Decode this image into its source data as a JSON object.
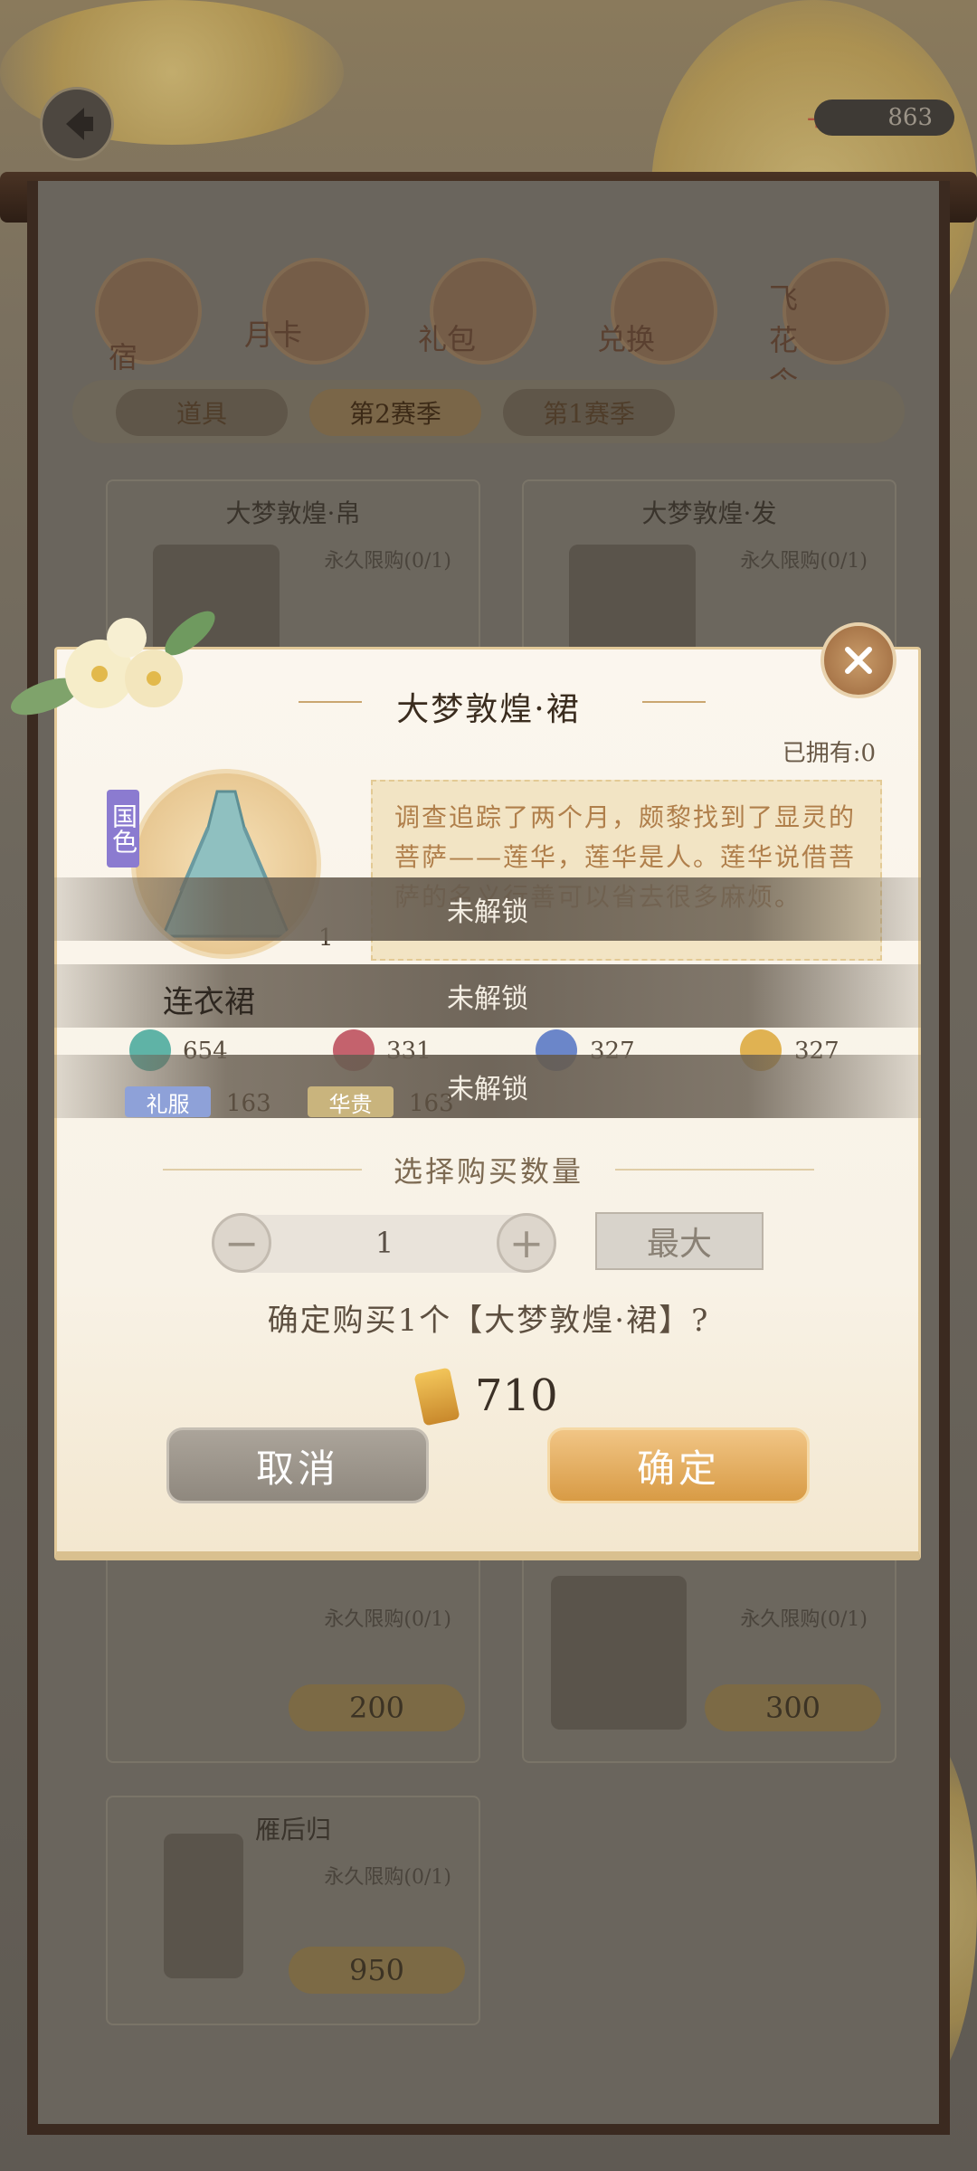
{
  "header": {
    "currency_value": "863",
    "currency_icon": "ticket-icon"
  },
  "categories": [
    {
      "label": "宿"
    },
    {
      "label": "月卡"
    },
    {
      "label": "礼包"
    },
    {
      "label": "兑换"
    },
    {
      "label": "飞花令"
    }
  ],
  "tabs": [
    {
      "label": "道具"
    },
    {
      "label": "第2赛季"
    },
    {
      "label": "第1赛季"
    }
  ],
  "shop_items": [
    {
      "name": "大梦敦煌·帛",
      "limit": "永久限购(0/1)"
    },
    {
      "name": "大梦敦煌·发",
      "limit": "永久限购(0/1)"
    },
    {
      "name": "",
      "limit": "永久限购(0/1)",
      "price": "200"
    },
    {
      "name": "",
      "limit": "永久限购(0/1)",
      "price": "300"
    },
    {
      "name": "雁后归",
      "limit": "永久限购(0/1)",
      "price": "950"
    }
  ],
  "dialog": {
    "title": "大梦敦煌·裙",
    "owned": "已拥有:0",
    "badge": "国色",
    "item_count": "1",
    "description": "调查追踪了两个月，颇黎找到了显灵的菩萨——莲华，莲华是人。莲华说借菩萨的名义行善可以省去很多麻烦。",
    "item_type": "连衣裙",
    "locked_label": "未解锁",
    "stats": [
      {
        "icon": "jade-flower-icon",
        "value": "654",
        "color": "#5fb3a6"
      },
      {
        "icon": "lotus-icon",
        "value": "331",
        "color": "#c4626d"
      },
      {
        "icon": "snowflake-icon",
        "value": "327",
        "color": "#6b86c9"
      },
      {
        "icon": "moon-icon",
        "value": "327",
        "color": "#e0b252"
      }
    ],
    "tags": [
      {
        "label": "礼服",
        "value": "163",
        "color": "#8ea1d8"
      },
      {
        "label": "华贵",
        "value": "163",
        "color": "#c9b47d"
      }
    ],
    "quantity_label": "选择购买数量",
    "quantity": "1",
    "minus": "−",
    "plus": "+",
    "max_label": "最大",
    "confirm_text": "确定购买1个【大梦敦煌·裙】?",
    "cost": "710",
    "cancel_label": "取消",
    "ok_label": "确定"
  }
}
